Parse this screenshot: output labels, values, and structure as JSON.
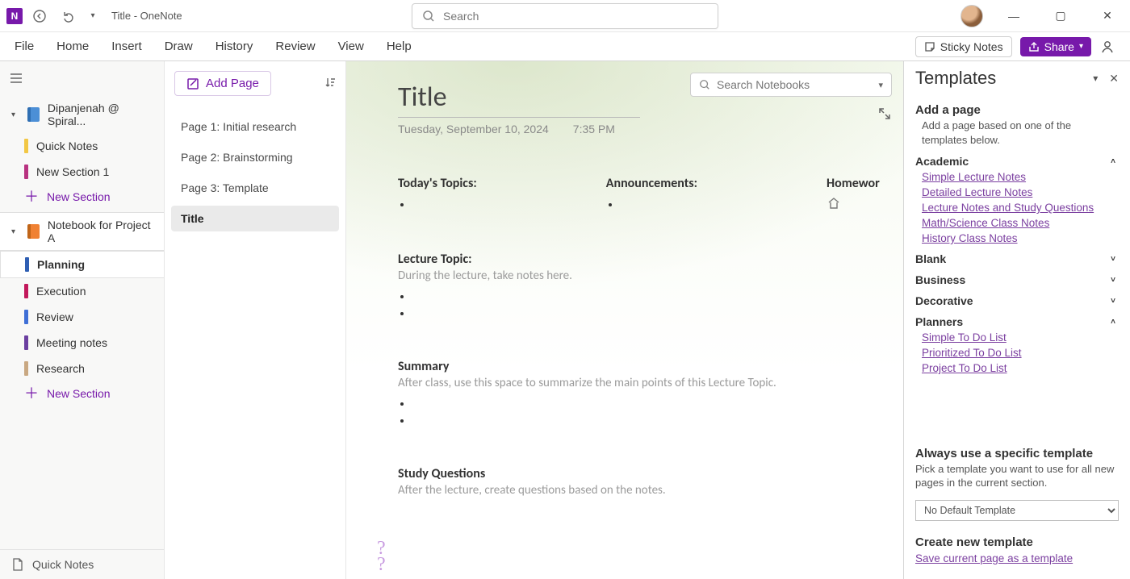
{
  "title_bar": {
    "app_title": "Title  -  OneNote",
    "global_search_placeholder": "Search"
  },
  "window_controls": {
    "minimize": "—",
    "maximize": "▢",
    "close": "✕"
  },
  "ribbon": {
    "tabs": [
      "File",
      "Home",
      "Insert",
      "Draw",
      "History",
      "Review",
      "View",
      "Help"
    ],
    "sticky": "Sticky Notes",
    "share": "Share"
  },
  "notebook_search_placeholder": "Search Notebooks",
  "sidebar": {
    "notebooks": [
      {
        "name": "Dipanjenah @ Spiral...",
        "expanded": true,
        "color": "blue",
        "sections": [
          {
            "label": "Quick Notes",
            "color": "#F2C744"
          },
          {
            "label": "New Section 1",
            "color": "#B83280"
          }
        ],
        "new_section": "New Section"
      },
      {
        "name": "Notebook for Project A",
        "expanded": true,
        "color": "orange",
        "sections": [
          {
            "label": "Planning",
            "color": "#2F5FB3",
            "selected": true
          },
          {
            "label": "Execution",
            "color": "#C2185B"
          },
          {
            "label": "Review",
            "color": "#3F6FD6"
          },
          {
            "label": "Meeting notes",
            "color": "#6B3FA0"
          },
          {
            "label": "Research",
            "color": "#C9A882"
          }
        ],
        "new_section": "New Section"
      }
    ],
    "footer": "Quick Notes"
  },
  "pages": {
    "add_page": "Add Page",
    "list": [
      {
        "label": "Page 1: Initial research"
      },
      {
        "label": "Page 2: Brainstorming"
      },
      {
        "label": "Page 3: Template"
      },
      {
        "label": "Title",
        "active": true
      }
    ]
  },
  "note": {
    "title": "Title",
    "date": "Tuesday, September 10, 2024",
    "time": "7:35 PM",
    "row": {
      "topics": "Today's Topics:",
      "announce": "Announcements:",
      "homework": "Homewor"
    },
    "lecture": {
      "h": "Lecture Topic:",
      "sub": "During the lecture, take notes here."
    },
    "summary": {
      "h": "Summary",
      "sub": "After class, use this space to summarize the main points of this Lecture Topic."
    },
    "study": {
      "h": "Study Questions",
      "sub": "After the lecture, create questions based on the notes."
    }
  },
  "templates": {
    "title": "Templates",
    "add_h": "Add a page",
    "add_sub": "Add a page based on one of the templates below.",
    "cats": [
      {
        "name": "Academic",
        "open": true,
        "links": [
          "Simple Lecture Notes",
          "Detailed Lecture Notes",
          "Lecture Notes and Study Questions",
          "Math/Science Class Notes",
          "History Class Notes"
        ]
      },
      {
        "name": "Blank",
        "open": false
      },
      {
        "name": "Business",
        "open": false
      },
      {
        "name": "Decorative",
        "open": false
      },
      {
        "name": "Planners",
        "open": true,
        "links": [
          "Simple To Do List",
          "Prioritized To Do List",
          "Project To Do List"
        ]
      }
    ],
    "always_h": "Always use a specific template",
    "always_sub": "Pick a template you want to use for all new pages in the current section.",
    "always_select": "No Default Template",
    "create_h": "Create new template",
    "create_link": "Save current page as a template"
  }
}
